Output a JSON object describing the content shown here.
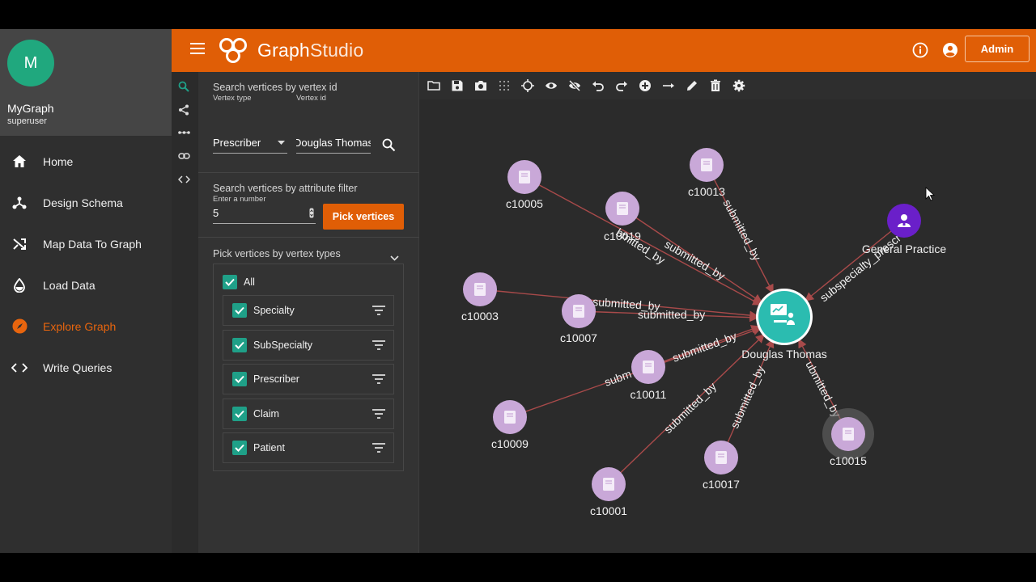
{
  "app": {
    "name": "GraphStudio",
    "name_part1": "Graph",
    "name_part2": "Studio"
  },
  "profile": {
    "initial": "M",
    "graph_name": "MyGraph",
    "role": "superuser"
  },
  "nav": {
    "items": [
      {
        "label": "Home",
        "icon": "home-icon"
      },
      {
        "label": "Design Schema",
        "icon": "schema-icon"
      },
      {
        "label": "Map Data To Graph",
        "icon": "shuffle-icon"
      },
      {
        "label": "Load Data",
        "icon": "drop-icon"
      },
      {
        "label": "Explore Graph",
        "icon": "compass-icon",
        "active": true
      },
      {
        "label": "Write Queries",
        "icon": "code-icon"
      }
    ]
  },
  "header": {
    "admin_label": "Admin"
  },
  "search_by_id": {
    "title": "Search vertices by vertex id",
    "type_label": "Vertex type",
    "type_value": "Prescriber",
    "id_label": "Vertex id",
    "id_value": "Douglas Thomas"
  },
  "search_by_attr": {
    "title": "Search vertices by attribute filter",
    "number_label": "Enter a number",
    "number_value": "5",
    "pick_button": "Pick vertices"
  },
  "pick_by_type": {
    "title": "Pick vertices by vertex types",
    "all_label": "All",
    "types": [
      "Specialty",
      "SubSpecialty",
      "Prescriber",
      "Claim",
      "Patient"
    ]
  },
  "colors": {
    "accent": "#e05e06",
    "check": "#1fa088",
    "claim_node": "#c9a8d8",
    "prescriber_node": "#2bbcb0",
    "subspecialty_node": "#6a1fc9",
    "edge": "#a84a4a"
  },
  "graph": {
    "center": {
      "label": "Douglas Thomas",
      "type": "Prescriber"
    },
    "specialty": {
      "label": "General Practice",
      "type": "SubSpecialty"
    },
    "claims": [
      "c10005",
      "c10013",
      "c10019",
      "c10003",
      "c10007",
      "c10011",
      "c10009",
      "c10017",
      "c10015",
      "c10001"
    ],
    "edge_labels": {
      "submitted_by": "submitted_by",
      "subspecialty": "subspecialty_prescr",
      "partial_a": "submitted_by",
      "partial_b": "submitted_by",
      "partial_c": "subm",
      "partial_d": "submitted_by",
      "partial_e": "submitted_by",
      "partial_f": "ubmitted_by",
      "partial_g": "bmitted_by",
      "partial_h": "submitted_by",
      "partial_i": "submitted_by"
    }
  }
}
